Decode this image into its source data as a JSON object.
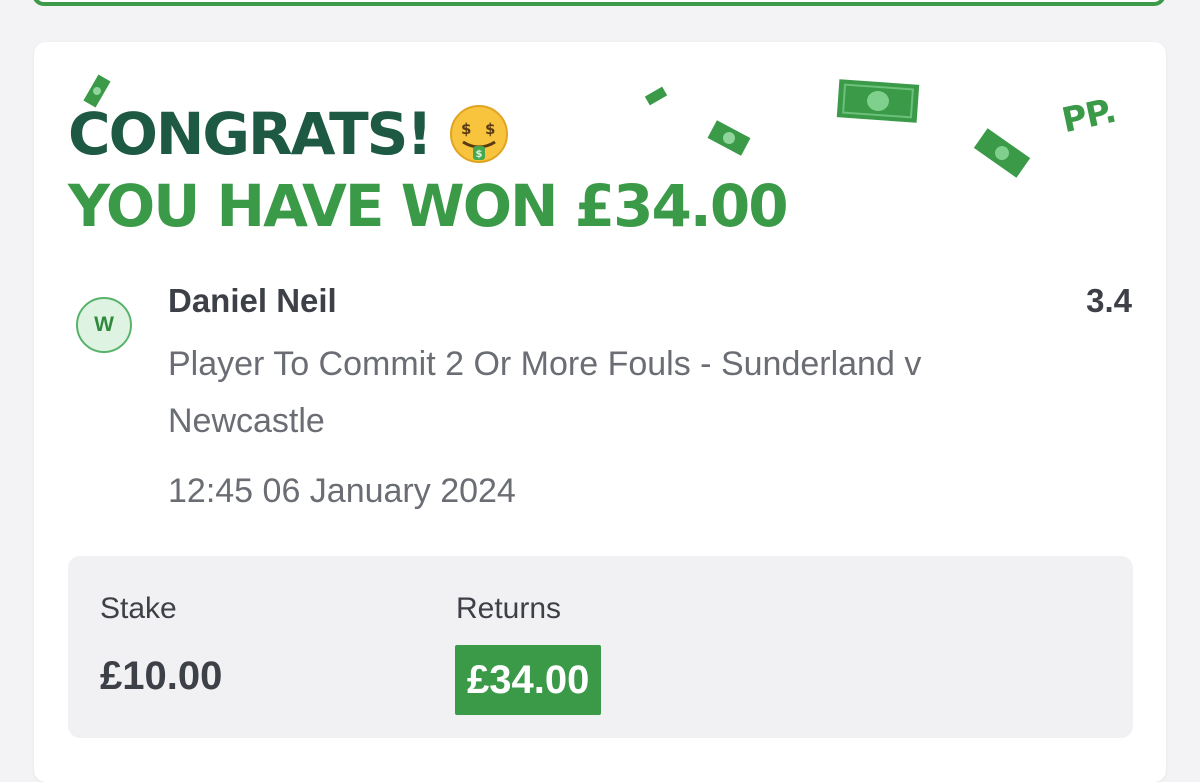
{
  "header": {
    "congrats_text": "CONGRATS!",
    "win_text": "YOU HAVE WON £34.00",
    "brand_logo_text": "PP.",
    "emoji_icon": "money-mouth-face-icon",
    "confetti_icon": "banknote-icon"
  },
  "bet": {
    "result_badge": "W",
    "selection": "Daniel Neil",
    "odds": "3.4",
    "market": "Player To Commit 2 Or More Fouls - Sunderland v Newcastle",
    "datetime": "12:45 06 January 2024"
  },
  "summary": {
    "stake_label": "Stake",
    "stake_value": "£10.00",
    "returns_label": "Returns",
    "returns_value": "£34.00"
  },
  "colors": {
    "dark_green": "#1e5a43",
    "brand_green": "#3a9a48",
    "text_dark": "#3d4047",
    "text_muted": "#6a6d73",
    "badge_bg": "#dff3e3"
  }
}
